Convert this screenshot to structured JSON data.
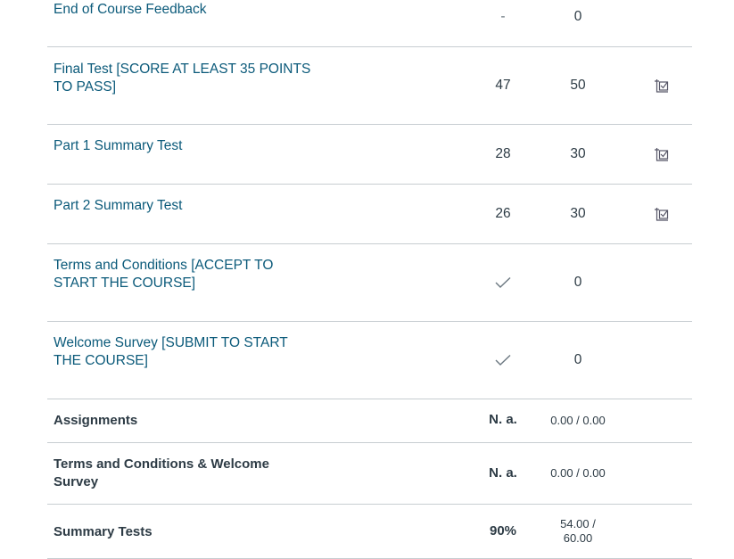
{
  "rows": [
    {
      "name": "End of Course Feedback",
      "score": "-",
      "out_of": "0"
    },
    {
      "name": "Final Test [SCORE AT LEAST 35 POINTS TO PASS]",
      "name_line1": "Final Test [SCORE AT LEAST 35 POINTS",
      "name_line2": "TO PASS]",
      "score": "47",
      "out_of": "50",
      "icon": "submission-icon"
    },
    {
      "name": "Part 1 Summary Test",
      "score": "28",
      "out_of": "30",
      "icon": "submission-icon"
    },
    {
      "name": "Part 2 Summary Test",
      "score": "26",
      "out_of": "30",
      "icon": "submission-icon"
    },
    {
      "name": "Terms and Conditions [ACCEPT TO START THE COURSE]",
      "name_line1": "Terms and Conditions [ACCEPT TO",
      "name_line2": "START THE COURSE]",
      "score_icon": "checkmark-icon",
      "out_of": "0"
    },
    {
      "name": "Welcome Survey [SUBMIT TO START THE COURSE]",
      "name_line1": "Welcome Survey [SUBMIT TO START",
      "name_line2": "THE COURSE]",
      "score_icon": "checkmark-icon",
      "out_of": "0"
    }
  ],
  "groups": [
    {
      "name": "Assignments",
      "score": "N. a.",
      "out_of": "0.00 / 0.00"
    },
    {
      "name_line1": "Terms and Conditions & Welcome",
      "name_line2": "Survey",
      "score": "N. a.",
      "out_of": "0.00 / 0.00"
    },
    {
      "name": "Summary Tests",
      "score": "90%",
      "out_of_line1": "54.00 /",
      "out_of_line2": "60.00"
    }
  ]
}
